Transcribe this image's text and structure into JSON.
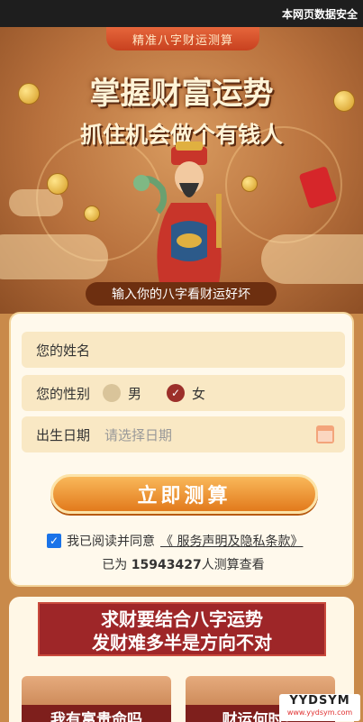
{
  "topbar": {
    "notice": "本网页数据安全"
  },
  "hero": {
    "tag": "精准八字财运测算",
    "title_line1": "掌握财富运势",
    "title_line2": "抓住机会做个有钱人",
    "subtitle": "输入你的八字看财运好坏"
  },
  "form": {
    "name_placeholder": "您的姓名",
    "gender_label": "您的性别",
    "gender_options": [
      "男",
      "女"
    ],
    "gender_selected": "女",
    "birth_label": "出生日期",
    "birth_placeholder": "请选择日期",
    "submit_label": "立即测算",
    "agree_text": "我已阅读并同意",
    "agree_link": "《 服务声明及隐私条款》",
    "agree_checked": true,
    "count_prefix": "已为",
    "count_value": "15943427",
    "count_suffix": "人测算查看"
  },
  "section": {
    "banner_line1": "求财要结合八字运势",
    "banner_line2": "发财难多半是方向不对",
    "card_left": "我有富贵命吗",
    "card_right": "财运何时？"
  },
  "watermark": {
    "brand": "YYDSYM",
    "url": "www.yydsym.com"
  },
  "colors": {
    "accent": "#9e2628",
    "button": "#e27a1c",
    "field_bg": "#f9e8c4"
  }
}
